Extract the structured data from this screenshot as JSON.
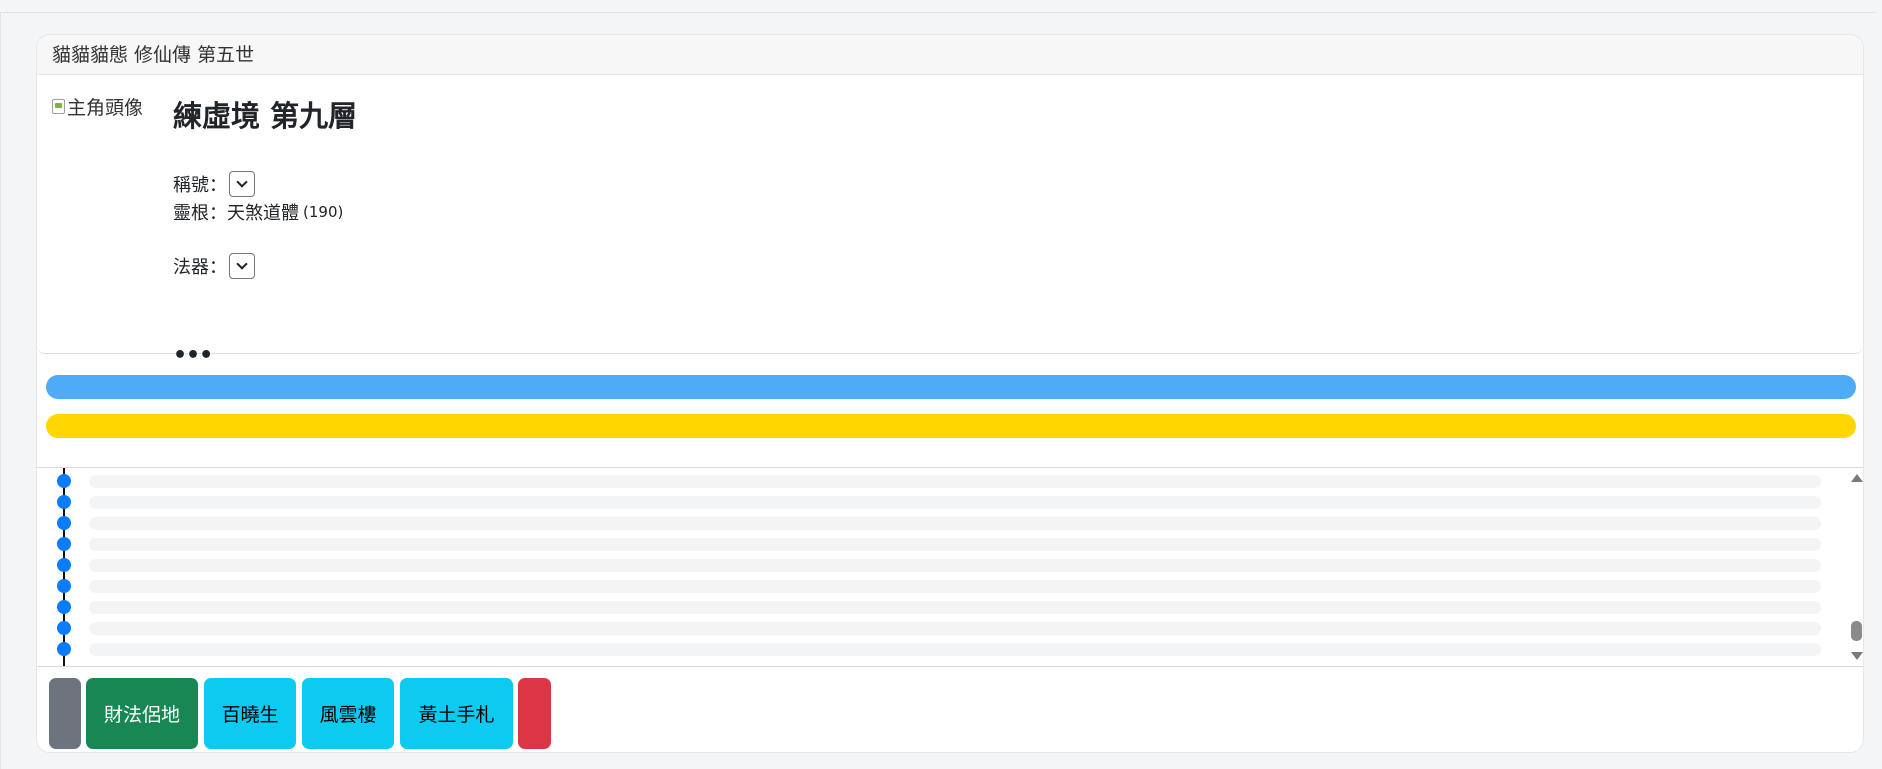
{
  "header": {
    "title": "貓貓貓態 修仙傳 第五世"
  },
  "profile": {
    "avatar_alt": "主角頭像",
    "realm": "練虛境 第九層",
    "title_label": "稱號：",
    "title_value": "",
    "spirit_root_label": "靈根：",
    "spirit_root_value": "天煞道體",
    "spirit_root_score": "(190)",
    "artifact_label": "法器：",
    "artifact_value": "",
    "more": "•••"
  },
  "bars": [
    {
      "name": "blue-progress",
      "color": "#4dabf7",
      "fill": 1.0
    },
    {
      "name": "yellow-progress",
      "color": "#ffd600",
      "fill": 1.0
    }
  ],
  "log": {
    "row_count": 9
  },
  "buttons": [
    {
      "label": "",
      "color": "#6c757d"
    },
    {
      "label": "財法侶地",
      "color": "#198754"
    },
    {
      "label": "百曉生",
      "color": "#0dcaf0"
    },
    {
      "label": "風雲樓",
      "color": "#0dcaf0"
    },
    {
      "label": "黃土手札",
      "color": "#0dcaf0"
    },
    {
      "label": "",
      "color": "#dc3545"
    }
  ],
  "colors": {
    "timeline_dot": "#0a7cff",
    "background": "#f4f5f7"
  }
}
